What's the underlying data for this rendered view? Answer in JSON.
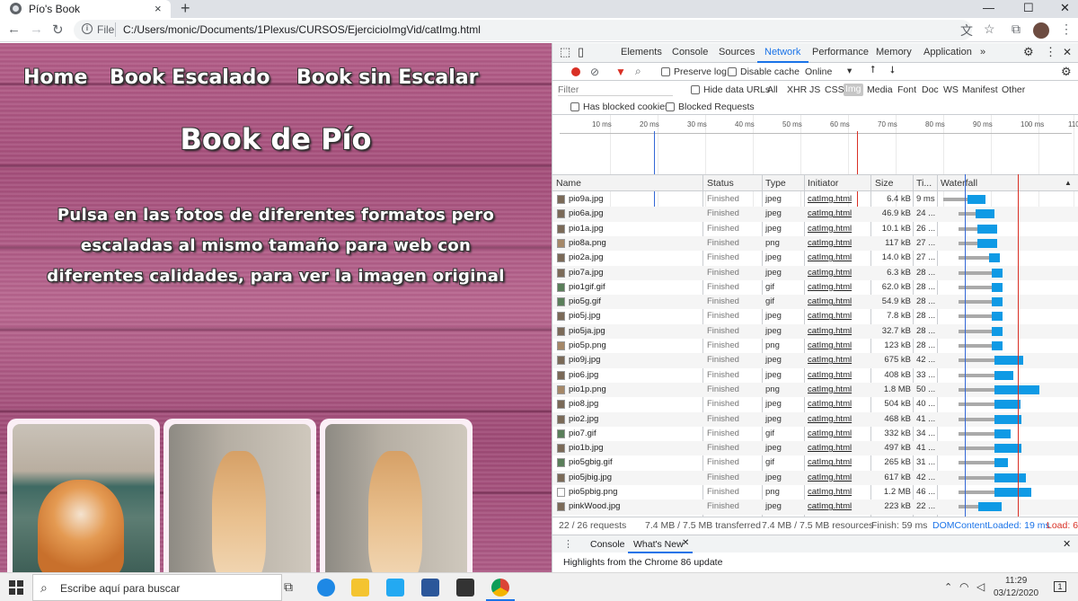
{
  "browser": {
    "tab_title": "Pío's Book",
    "tab_close": "×",
    "new_tab": "+",
    "window_controls": {
      "minimize": "—",
      "maximize": "☐",
      "close": "✕"
    },
    "nav": {
      "back": "←",
      "forward": "→",
      "reload": "↻"
    },
    "address": {
      "scheme": "File",
      "url": "C:/Users/monic/Documents/1Plexus/CURSOS/EjercicioImgVid/catImg.html"
    },
    "toolbar_icons": {
      "translate": "文",
      "star": "☆",
      "extensions": "⧉",
      "menu": "⋮"
    }
  },
  "page": {
    "nav_links": [
      "Home",
      "Book Escalado",
      "Book sin Escalar"
    ],
    "heading": "Book de Pío",
    "intro": "Pulsa en las fotos de diferentes formatos pero escaladas al mismo tamaño para web con diferentes calidades, para ver la imagen original"
  },
  "devtools": {
    "tabs": [
      "Elements",
      "Console",
      "Sources",
      "Network",
      "Performance",
      "Memory",
      "Application",
      "»"
    ],
    "active_tab": "Network",
    "toolbar": {
      "preserve_log": "Preserve log",
      "disable_cache": "Disable cache",
      "throttle": "Online"
    },
    "filter": {
      "placeholder": "Filter",
      "hide_data_urls": "Hide data URLs",
      "types": [
        "All",
        "XHR",
        "JS",
        "CSS",
        "Img",
        "Media",
        "Font",
        "Doc",
        "WS",
        "Manifest",
        "Other"
      ],
      "active_type": "Img",
      "has_blocked_cookies": "Has blocked cookies",
      "blocked_requests": "Blocked Requests"
    },
    "overview_ticks": [
      "10 ms",
      "20 ms",
      "30 ms",
      "40 ms",
      "50 ms",
      "60 ms",
      "70 ms",
      "80 ms",
      "90 ms",
      "100 ms",
      "110"
    ],
    "columns": [
      "Name",
      "Status",
      "Type",
      "Initiator",
      "Size",
      "Ti...",
      "Waterfall"
    ],
    "rows": [
      {
        "name": "pio9a.jpg",
        "status": "Finished",
        "type": "jpeg",
        "initiator": "catImg.html",
        "size": "6.4 kB",
        "time": "9 ms"
      },
      {
        "name": "pio6a.jpg",
        "status": "Finished",
        "type": "jpeg",
        "initiator": "catImg.html",
        "size": "46.9 kB",
        "time": "24 ..."
      },
      {
        "name": "pio1a.jpg",
        "status": "Finished",
        "type": "jpeg",
        "initiator": "catImg.html",
        "size": "10.1 kB",
        "time": "26 ..."
      },
      {
        "name": "pio8a.png",
        "status": "Finished",
        "type": "png",
        "initiator": "catImg.html",
        "size": "117 kB",
        "time": "27 ..."
      },
      {
        "name": "pio2a.jpg",
        "status": "Finished",
        "type": "jpeg",
        "initiator": "catImg.html",
        "size": "14.0 kB",
        "time": "27 ..."
      },
      {
        "name": "pio7a.jpg",
        "status": "Finished",
        "type": "jpeg",
        "initiator": "catImg.html",
        "size": "6.3 kB",
        "time": "28 ..."
      },
      {
        "name": "pio1gif.gif",
        "status": "Finished",
        "type": "gif",
        "initiator": "catImg.html",
        "size": "62.0 kB",
        "time": "28 ..."
      },
      {
        "name": "pio5g.gif",
        "status": "Finished",
        "type": "gif",
        "initiator": "catImg.html",
        "size": "54.9 kB",
        "time": "28 ..."
      },
      {
        "name": "pio5j.jpg",
        "status": "Finished",
        "type": "jpeg",
        "initiator": "catImg.html",
        "size": "7.8 kB",
        "time": "28 ..."
      },
      {
        "name": "pio5ja.jpg",
        "status": "Finished",
        "type": "jpeg",
        "initiator": "catImg.html",
        "size": "32.7 kB",
        "time": "28 ..."
      },
      {
        "name": "pio5p.png",
        "status": "Finished",
        "type": "png",
        "initiator": "catImg.html",
        "size": "123 kB",
        "time": "28 ..."
      },
      {
        "name": "pio9j.jpg",
        "status": "Finished",
        "type": "jpeg",
        "initiator": "catImg.html",
        "size": "675 kB",
        "time": "42 ..."
      },
      {
        "name": "pio6.jpg",
        "status": "Finished",
        "type": "jpeg",
        "initiator": "catImg.html",
        "size": "408 kB",
        "time": "33 ..."
      },
      {
        "name": "pio1p.png",
        "status": "Finished",
        "type": "png",
        "initiator": "catImg.html",
        "size": "1.8 MB",
        "time": "50 ..."
      },
      {
        "name": "pio8.jpg",
        "status": "Finished",
        "type": "jpeg",
        "initiator": "catImg.html",
        "size": "504 kB",
        "time": "40 ..."
      },
      {
        "name": "pio2.jpg",
        "status": "Finished",
        "type": "jpeg",
        "initiator": "catImg.html",
        "size": "468 kB",
        "time": "41 ..."
      },
      {
        "name": "pio7.gif",
        "status": "Finished",
        "type": "gif",
        "initiator": "catImg.html",
        "size": "332 kB",
        "time": "34 ..."
      },
      {
        "name": "pio1b.jpg",
        "status": "Finished",
        "type": "jpeg",
        "initiator": "catImg.html",
        "size": "497 kB",
        "time": "41 ..."
      },
      {
        "name": "pio5gbig.gif",
        "status": "Finished",
        "type": "gif",
        "initiator": "catImg.html",
        "size": "265 kB",
        "time": "31 ..."
      },
      {
        "name": "pio5jbig.jpg",
        "status": "Finished",
        "type": "jpeg",
        "initiator": "catImg.html",
        "size": "617 kB",
        "time": "42 ..."
      },
      {
        "name": "pio5pbig.png",
        "status": "Finished",
        "type": "png",
        "initiator": "catImg.html",
        "size": "1.2 MB",
        "time": "46 ..."
      },
      {
        "name": "pinkWood.jpg",
        "status": "Finished",
        "type": "jpeg",
        "initiator": "catImg.html",
        "size": "223 kB",
        "time": "22 ..."
      }
    ],
    "status_bar": {
      "requests": "22 / 26 requests",
      "transferred": "7.4 MB / 7.5 MB transferred",
      "resources": "7.4 MB / 7.5 MB resources",
      "finish": "Finish: 59 ms",
      "dcl": "DOMContentLoaded: 19 ms",
      "load": "Load: 6"
    },
    "drawer": {
      "tabs": [
        "Console",
        "What's New"
      ],
      "active": "What's New",
      "message": "Highlights from the Chrome 86 update"
    }
  },
  "taskbar": {
    "search_placeholder": "Escribe aquí para buscar",
    "clock_time": "11:29",
    "clock_date": "03/12/2020",
    "notifications": "1"
  },
  "colors": {
    "accent": "#1a73e8",
    "dcl_line": "#3367d6",
    "load_line": "#d93025",
    "bar_fill": "#0f9ae5"
  }
}
